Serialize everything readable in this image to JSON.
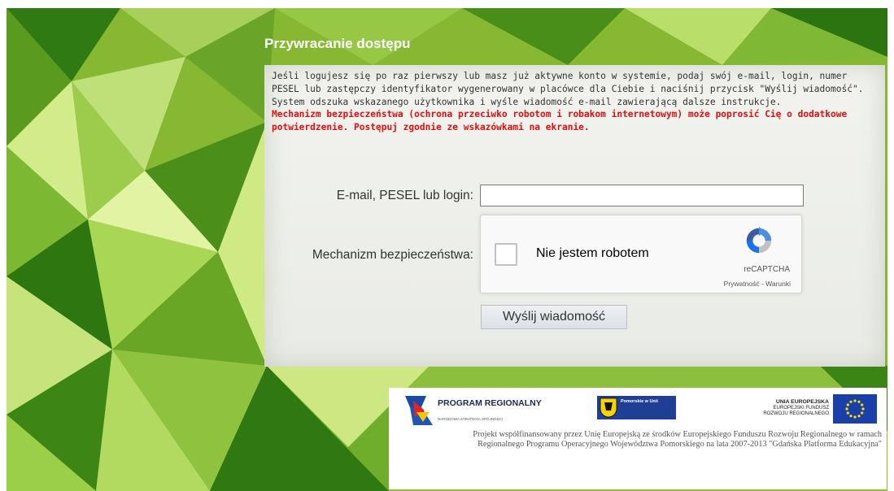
{
  "panel": {
    "title": "Przywracanie dostępu",
    "description": "Jeśli logujesz się po raz pierwszy lub masz już aktywne konto w systemie, podaj swój e-mail, login, numer PESEL lub zastępczy identyfikator wygenerowany w placówce dla Ciebie i naciśnij przycisk \"Wyślij wiadomość\". System odszuka wskazanego użytkownika i wyśle wiadomość e-mail zawierającą dalsze instrukcje.",
    "warning": "Mechanizm bezpieczeństwa (ochrona przeciwko robotom i robakom internetowym) może poprosić Cię o dodatkowe potwierdzenie. Postępuj zgodnie ze wskazówkami na ekranie."
  },
  "form": {
    "email_label": "E-mail, PESEL lub login:",
    "email_value": "",
    "security_label": "Mechanizm bezpieczeństwa:",
    "send_button": "Wyślij wiadomość"
  },
  "recaptcha": {
    "checkbox_label": "Nie jestem robotem",
    "brand": "reCAPTCHA",
    "links": "Prywatność - Warunki",
    "checked": false,
    "icon": "recaptcha-logo-icon"
  },
  "footer": {
    "logo_program": "PROGRAM REGIONALNY",
    "logo_program_sub": "NARODOWA STRATEGIA SPÓJNOŚCI",
    "logo_pomorskie": "Pomorskie w Unii",
    "logo_ue_title": "UNIA EUROPEJSKA",
    "logo_ue_sub": "EUROPEJSKI FUNDUSZ ROZWOJU REGIONALNEGO",
    "text": "Projekt współfinansowany przez Unię Europejską ze środków Europejskiego Funduszu Rozwoju Regionalnego w ramach Regionalnego Programu Operacyjnego Województwa Pomorskiego na lata 2007-2013 \"Gdańska Platforma Edukacyjna\""
  },
  "colors": {
    "warning": "#e01010",
    "panel_bg": "#eef0ec",
    "background_green": "#7fb52c"
  }
}
